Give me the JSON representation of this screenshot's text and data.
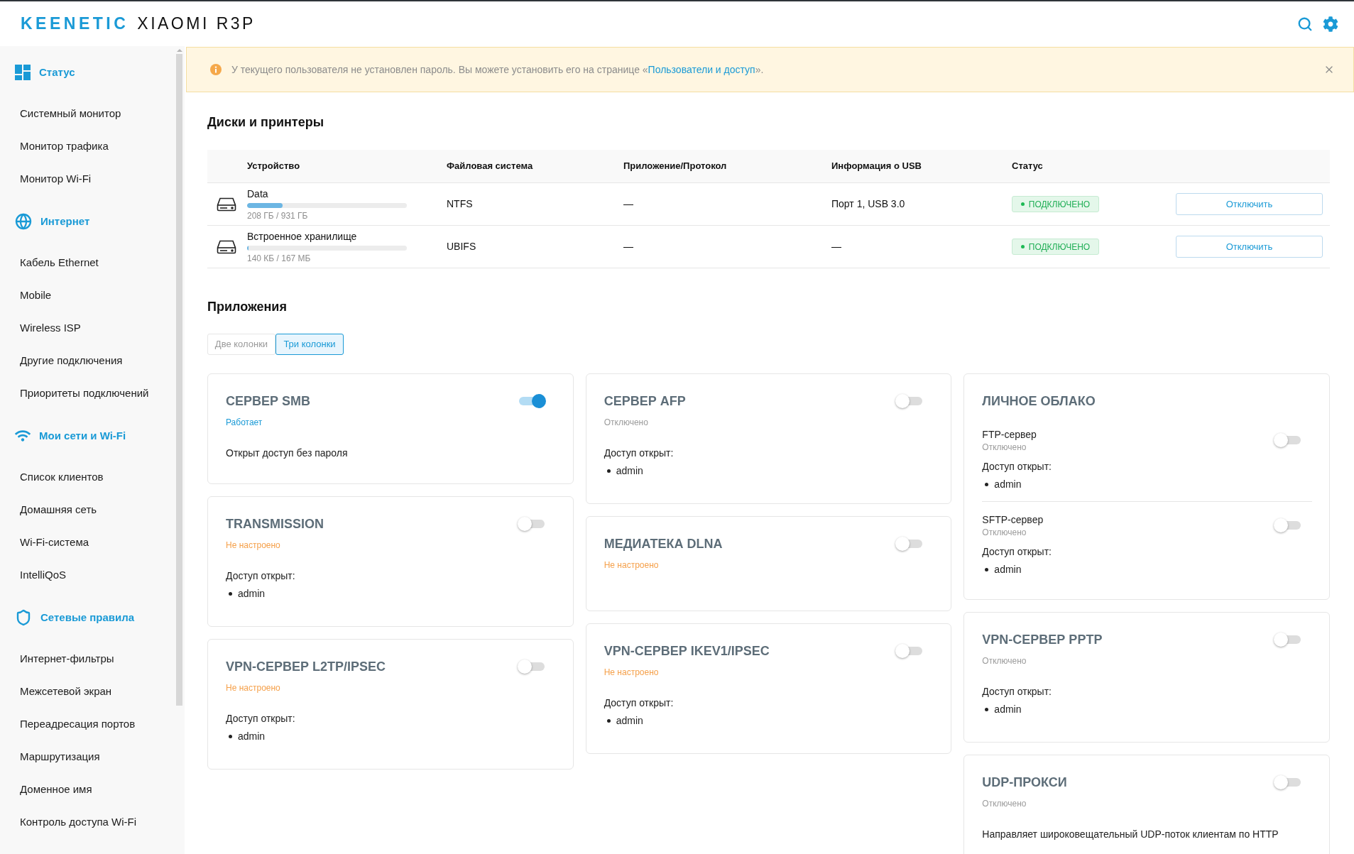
{
  "header": {
    "logo": "KEENETIC",
    "model": "XIAOMI R3P"
  },
  "sidebar": {
    "sections": [
      {
        "title": "Статус",
        "items": [
          "Системный монитор",
          "Монитор трафика",
          "Монитор Wi-Fi"
        ]
      },
      {
        "title": "Интернет",
        "items": [
          "Кабель Ethernet",
          "Mobile",
          "Wireless ISP",
          "Другие подключения",
          "Приоритеты подключений"
        ]
      },
      {
        "title": "Мои сети и Wi-Fi",
        "items": [
          "Список клиентов",
          "Домашняя сеть",
          "Wi-Fi-система",
          "IntelliQoS"
        ]
      },
      {
        "title": "Сетевые правила",
        "items": [
          "Интернет-фильтры",
          "Межсетевой экран",
          "Переадресация портов",
          "Маршрутизация",
          "Доменное имя",
          "Контроль доступа Wi-Fi"
        ]
      }
    ]
  },
  "banner": {
    "text_before": "У текущего пользователя не установлен пароль. Вы можете установить его на странице «",
    "link": "Пользователи и доступ",
    "text_after": "»."
  },
  "disks": {
    "title": "Диски и принтеры",
    "columns": [
      "Устройство",
      "Файловая система",
      "Приложение/Протокол",
      "Информация о USB",
      "Статус"
    ],
    "rows": [
      {
        "name": "Data",
        "level": 0.22,
        "usage": "208 ГБ / 931 ГБ",
        "filesystem": "NTFS",
        "protocol": "—",
        "usb": "Порт 1, USB 3.0",
        "status": "ПОДКЛЮЧЕНО",
        "action": "Отключить"
      },
      {
        "name": "Встроенное хранилище",
        "level": 0.01,
        "usage": "140 КБ / 167 МБ",
        "filesystem": "UBIFS",
        "protocol": "—",
        "usb": "—",
        "status": "ПОДКЛЮЧЕНО",
        "action": "Отключить"
      }
    ]
  },
  "apps": {
    "title": "Приложения",
    "layout_tabs": [
      {
        "label": "Две колонки",
        "selected": false
      },
      {
        "label": "Три колонки",
        "selected": true
      }
    ],
    "columns": [
      {
        "cards": [
          {
            "kind": "service",
            "title": "СЕРВЕР SMB",
            "on": true,
            "status": {
              "text": "Работает",
              "color": "#1a9ad6"
            },
            "description": "Открыт доступ без пароля"
          },
          {
            "kind": "service",
            "title": "TRANSMISSION",
            "on": false,
            "status": {
              "text": "Не настроено",
              "color": "#f5a04a"
            },
            "access_label": "Доступ открыт:",
            "users": [
              "admin"
            ]
          },
          {
            "kind": "service",
            "title": "VPN-СЕРВЕР L2TP/IPSEC",
            "on": false,
            "status": {
              "text": "Не настроено",
              "color": "#f5a04a"
            },
            "access_label": "Доступ открыт:",
            "users": [
              "admin"
            ]
          }
        ]
      },
      {
        "cards": [
          {
            "kind": "service",
            "title": "СЕРВЕР AFP",
            "on": false,
            "status": {
              "text": "Отключено",
              "color": "#9b9b9b"
            },
            "access_label": "Доступ открыт:",
            "users": [
              "admin"
            ]
          },
          {
            "kind": "service",
            "title": "МЕДИАТЕКА DLNA",
            "on": false,
            "status": {
              "text": "Не настроено",
              "color": "#f5a04a"
            }
          },
          {
            "kind": "service",
            "title": "VPN-СЕРВЕР IKEV1/IPSEC",
            "on": false,
            "status": {
              "text": "Не настроено",
              "color": "#f5a04a"
            },
            "access_label": "Доступ открыт:",
            "users": [
              "admin"
            ]
          }
        ]
      },
      {
        "cards": [
          {
            "kind": "group",
            "title": "ЛИЧНОЕ ОБЛАКО",
            "services": [
              {
                "name": "FTP-сервер",
                "on": false,
                "status": {
                  "text": "Отключено",
                  "color": "#9b9b9b"
                },
                "access_label": "Доступ открыт:",
                "users": [
                  "admin"
                ]
              },
              {
                "name": "SFTP-сервер",
                "on": false,
                "status": {
                  "text": "Отключено",
                  "color": "#9b9b9b"
                },
                "access_label": "Доступ открыт:",
                "users": [
                  "admin"
                ]
              }
            ]
          },
          {
            "kind": "service",
            "title": "VPN-СЕРВЕР PPTP",
            "on": false,
            "status": {
              "text": "Отключено",
              "color": "#9b9b9b"
            },
            "access_label": "Доступ открыт:",
            "users": [
              "admin"
            ]
          },
          {
            "kind": "service",
            "title": "UDP-ПРОКСИ",
            "on": false,
            "status": {
              "text": "Отключено",
              "color": "#9b9b9b"
            },
            "description": "Направляет широковещательный UDP-поток клиентам по HTTP"
          }
        ]
      }
    ]
  }
}
